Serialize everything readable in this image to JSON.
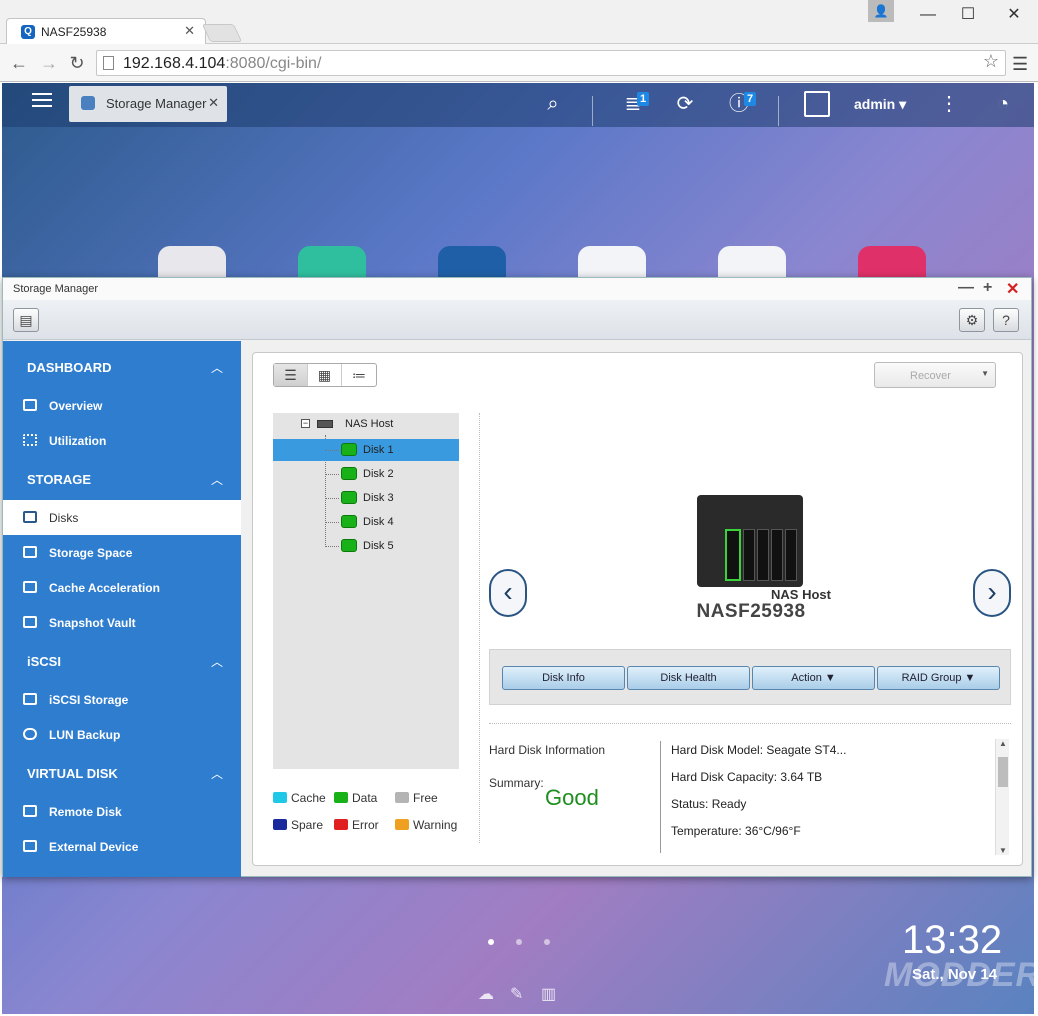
{
  "browser": {
    "tab_title": "NASF25938",
    "tab_favicon": "Q",
    "url_host": "192.168.4.104",
    "url_rest": ":8080/cgi-bin/",
    "window_controls": [
      "—",
      "☐",
      "✕"
    ]
  },
  "qnap_bar": {
    "active_app": "Storage Manager",
    "notification_badge": "1",
    "info_badge": "7",
    "user": "admin"
  },
  "window": {
    "title": "Storage Manager"
  },
  "sidebar": {
    "sections": [
      {
        "label": "DASHBOARD",
        "items": [
          "Overview",
          "Utilization"
        ]
      },
      {
        "label": "STORAGE",
        "items": [
          "Disks",
          "Storage Space",
          "Cache Acceleration",
          "Snapshot Vault"
        ]
      },
      {
        "label": "iSCSI",
        "items": [
          "iSCSI Storage",
          "LUN Backup"
        ]
      },
      {
        "label": "VIRTUAL DISK",
        "items": [
          "Remote Disk",
          "External Device"
        ]
      }
    ],
    "selected": "Disks"
  },
  "toolbar": {
    "recover_label": "Recover"
  },
  "tree": {
    "root": "NAS Host",
    "disks": [
      "Disk 1",
      "Disk 2",
      "Disk 3",
      "Disk 4",
      "Disk 5"
    ],
    "selected": "Disk 1"
  },
  "legend": [
    {
      "label": "Cache",
      "color": "#1ec8e6"
    },
    {
      "label": "Data",
      "color": "#18b218"
    },
    {
      "label": "Free",
      "color": "#b4b4b4"
    },
    {
      "label": "Spare",
      "color": "#1a2a9c"
    },
    {
      "label": "Error",
      "color": "#e02020"
    },
    {
      "label": "Warning",
      "color": "#f0a020"
    }
  ],
  "device": {
    "label": "NAS Host",
    "name": "NASF25938"
  },
  "actions": [
    "Disk Info",
    "Disk Health",
    "Action",
    "RAID Group"
  ],
  "disk_info": {
    "heading": "Hard Disk Information",
    "summary_label": "Summary:",
    "summary_value": "Good",
    "model": "Hard Disk Model: Seagate ST4...",
    "capacity": "Hard Disk Capacity: 3.64 TB",
    "status": "Status: Ready",
    "temperature": "Temperature: 36°C/96°F"
  },
  "desktop": {
    "time": "13:32",
    "date": "Sat., Nov 14",
    "watermark": "MODDERS"
  },
  "colors": {
    "sidebar": "#2f7dcf",
    "selected_row": "#3a9ae0",
    "good": "#1e8e1e"
  }
}
